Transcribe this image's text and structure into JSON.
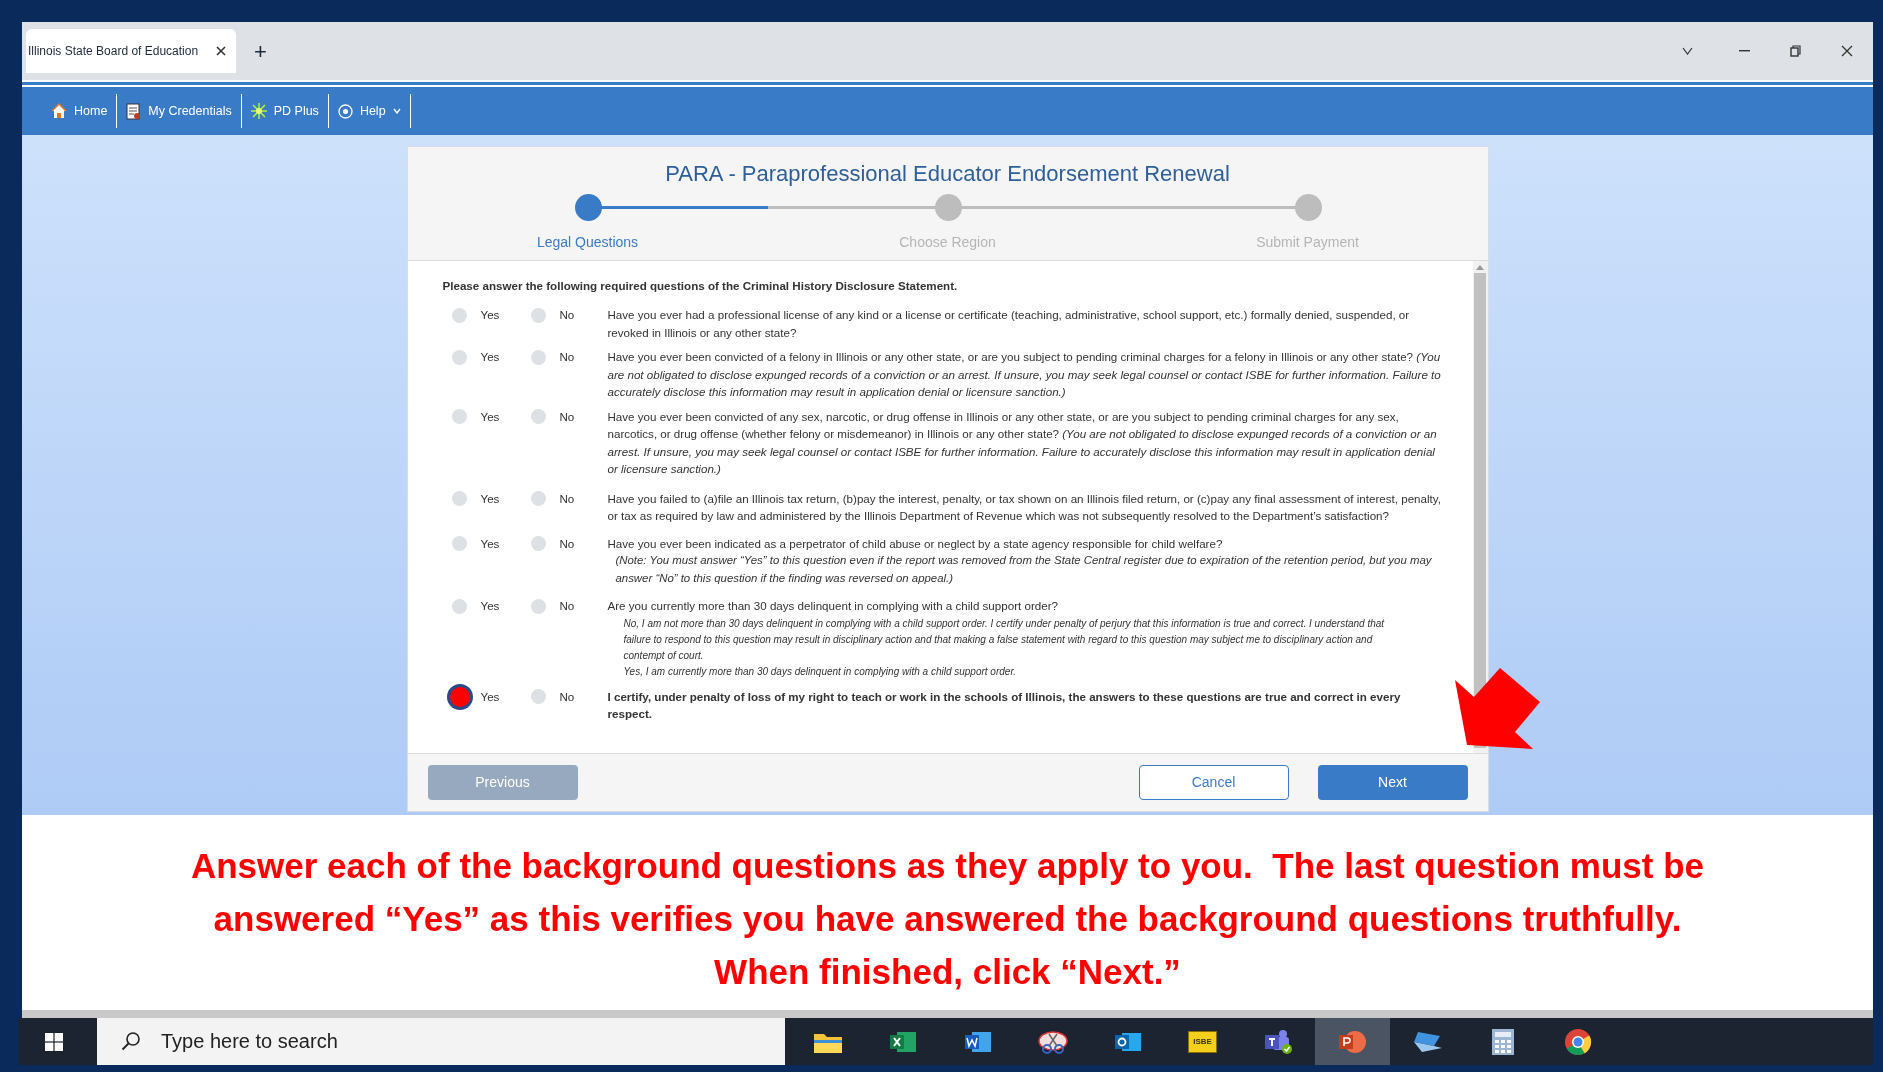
{
  "browser": {
    "tab_title": "Illinois State Board of Education",
    "new_tab": "+"
  },
  "nav": {
    "items": [
      {
        "label": "Home",
        "kind": "home"
      },
      {
        "label": "My Credentials",
        "kind": "credentials"
      },
      {
        "label": "PD Plus",
        "kind": "pd"
      },
      {
        "label": "Help",
        "kind": "help"
      }
    ]
  },
  "form": {
    "title": "PARA - Paraprofessional Educator Endorsement Renewal",
    "steps": [
      {
        "label": "Legal Questions",
        "selected": true
      },
      {
        "label": "Choose Region",
        "selected": false
      },
      {
        "label": "Submit Payment",
        "selected": false
      }
    ],
    "intro": "Please answer the following required questions of the Criminal History Disclosure Statement.",
    "questions": [
      {
        "kind": "question",
        "yes": {
          "label": "Yes",
          "selected": false
        },
        "no": {
          "label": "No",
          "selected": false
        },
        "text": "Have you ever had a professional license of any kind or a license or certificate (teaching, administrative, school support, etc.) formally denied, suspended, or revoked in Illinois or any other state?"
      },
      {
        "kind": "question",
        "yes": {
          "label": "Yes",
          "selected": false
        },
        "no": {
          "label": "No",
          "selected": false
        },
        "text": "Have you ever been convicted of a felony in Illinois or any other state, or are you subject to pending criminal charges for a felony in Illinois or any other state?    *(You are not obligated to disclose expunged records of a conviction or an arrest. If unsure, you may seek legal counsel or contact ISBE for further information. Failure to accurately disclose this information may result in application denial or licensure sanction.)*"
      },
      {
        "kind": "question",
        "yes": {
          "label": "Yes",
          "selected": false
        },
        "no": {
          "label": "No",
          "selected": false
        },
        "text": "Have you ever been convicted of any sex, narcotic, or drug offense in Illinois or any other state, or are you subject to pending criminal charges for any sex, narcotics, or drug offense (whether felony or misdemeanor) in Illinois or any other state?    *(You are not obligated to disclose expunged records of a conviction or an arrest. If unsure, you may seek legal counsel or contact ISBE for further information. Failure to accurately disclose this information may result in application denial or licensure sanction.)*"
      },
      {
        "kind": "question",
        "yes": {
          "label": "Yes",
          "selected": false
        },
        "no": {
          "label": "No",
          "selected": false
        },
        "text": "Have you failed to (a)file an Illinois tax return, (b)pay the interest, penalty, or tax shown on an Illinois filed return, or (c)pay any final assessment of interest, penalty, or tax as required by law and administered by the Illinois Department of Revenue which was not subsequently resolved to the Department’s satisfaction?"
      },
      {
        "kind": "question",
        "yes": {
          "label": "Yes",
          "selected": false
        },
        "no": {
          "label": "No",
          "selected": false
        },
        "text": "Have you ever been indicated as a perpetrator of child abuse or neglect by a state agency responsible for child welfare?",
        "note": "(Note: You must answer “Yes” to this question even if the report was removed from the State Central register due to expiration of the retention period, but you may answer “No” to this question if the finding was reversed on appeal.)"
      },
      {
        "kind": "question",
        "yes": {
          "label": "Yes",
          "selected": false
        },
        "no": {
          "label": "No",
          "selected": false
        },
        "text": "Are you currently more than 30 days delinquent in complying with a child support order?",
        "options": [
          "No, I am not more than 30 days delinquent in complying with a child support order. I certify under penalty of perjury that this information is true and correct. I understand that failure to respond to this question may result in disciplinary action and that making a false statement with regard to this question may subject me to disciplinary action and contempt of court.",
          "Yes, I am currently more than 30 days delinquent in complying with a child support order."
        ]
      },
      {
        "kind": "certification",
        "yes": {
          "label": "Yes",
          "selected": true
        },
        "no": {
          "label": "No",
          "selected": false
        },
        "text": "I certify, under penalty of loss of my right to teach or work in the schools of Illinois, the answers to these questions are true and correct in every respect."
      }
    ],
    "buttons": {
      "previous": {
        "label": "Previous",
        "disabled": true
      },
      "cancel": {
        "label": "Cancel"
      },
      "next": {
        "label": "Next"
      }
    }
  },
  "caption": [
    "Answer each of the background questions as they apply to you.  The last question must be",
    "answered “Yes” as this verifies you have answered the background questions truthfully.",
    "When finished, click “Next.”"
  ],
  "taskbar": {
    "search": {
      "placeholder": "Type here to search"
    },
    "apps": [
      {
        "kind": "folder",
        "selected": false
      },
      {
        "kind": "excel",
        "selected": false
      },
      {
        "kind": "word",
        "selected": false
      },
      {
        "kind": "snip",
        "selected": false
      },
      {
        "kind": "outlook",
        "selected": false
      },
      {
        "kind": "isbe",
        "label": "ISBE",
        "selected": false
      },
      {
        "kind": "teams",
        "selected": false
      },
      {
        "kind": "powerpoint",
        "selected": true
      },
      {
        "kind": "laptop",
        "selected": false
      },
      {
        "kind": "calculator",
        "selected": false
      },
      {
        "kind": "chrome",
        "selected": false
      }
    ]
  }
}
